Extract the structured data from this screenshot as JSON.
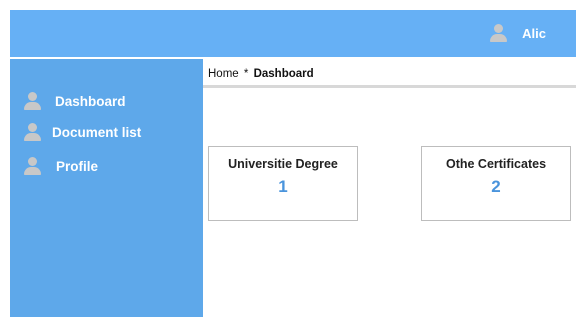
{
  "header": {
    "user_name": "Alic",
    "user_icon": "person-icon"
  },
  "sidebar": {
    "items": [
      {
        "label": "Dashboard",
        "icon": "person-icon"
      },
      {
        "label": "Document list",
        "icon": "person-icon"
      },
      {
        "label": "Profile",
        "icon": "person-icon"
      }
    ]
  },
  "breadcrumb": {
    "home": "Home",
    "separator": "*",
    "current": "Dashboard"
  },
  "cards": [
    {
      "title": "Universitie Degree",
      "value": "1"
    },
    {
      "title": "Othe Certificates",
      "value": "2"
    }
  ],
  "colors": {
    "header_bg": "#66b0f5",
    "sidebar_bg": "#5ea8ea",
    "card_value": "#4a94dc",
    "icon_gray": "#c8c8c8"
  }
}
